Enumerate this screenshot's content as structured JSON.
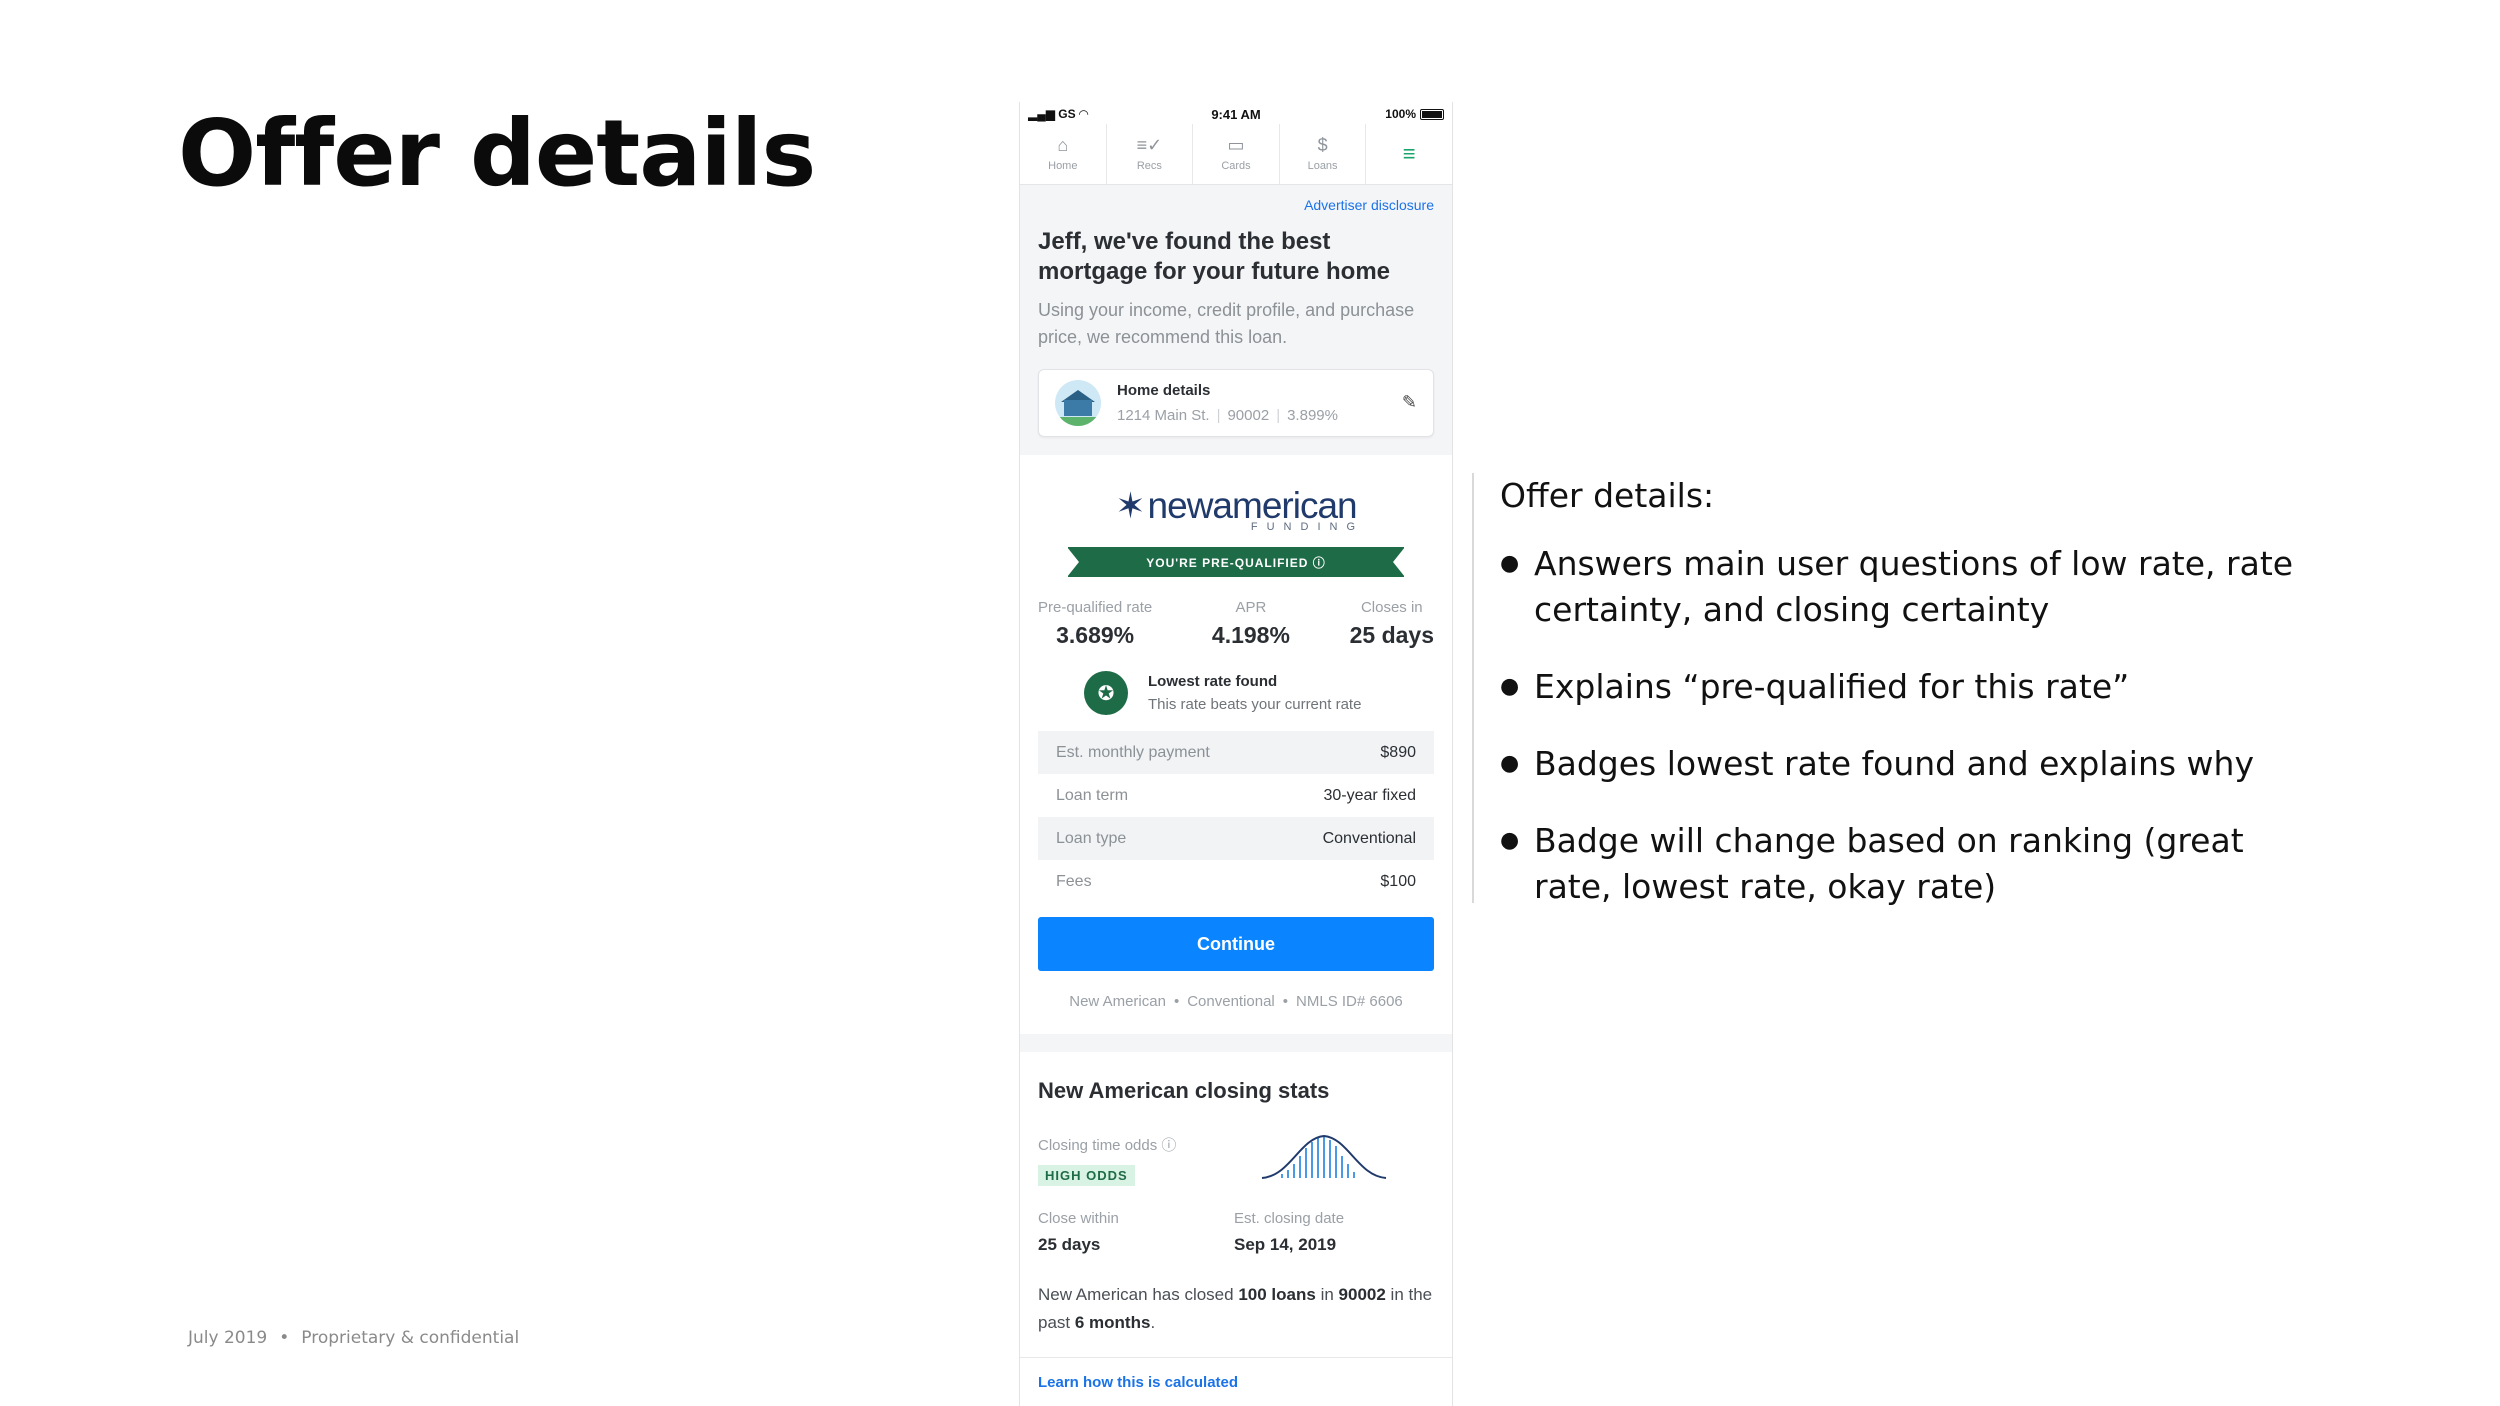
{
  "slide": {
    "title": "Offer details",
    "footer_date": "July 2019",
    "footer_sep": "•",
    "footer_note": "Proprietary & confidential"
  },
  "phone": {
    "status": {
      "carrier": "GS",
      "time": "9:41 AM",
      "battery": "100%"
    },
    "tabs": [
      {
        "label": "Home",
        "icon": "home-icon"
      },
      {
        "label": "Recs",
        "icon": "recs-icon"
      },
      {
        "label": "Cards",
        "icon": "card-icon"
      },
      {
        "label": "Loans",
        "icon": "dollar-icon"
      },
      {
        "label": "",
        "icon": "menu-icon"
      }
    ],
    "disclosure": "Advertiser disclosure",
    "headline": "Jeff, we've found the best mortgage for your future home",
    "subtext": "Using your income, credit profile, and purchase price, we recommend this loan.",
    "home_card": {
      "title": "Home details",
      "address": "1214 Main St.",
      "zip": "90002",
      "rate": "3.899%"
    },
    "offer": {
      "lender_name": "newamerican",
      "lender_tagline": "FUNDING",
      "prequalified_banner": "YOU'RE PRE-QUALIFIED ⓘ",
      "rates": [
        {
          "label": "Pre-qualified rate",
          "value": "3.689%"
        },
        {
          "label": "APR",
          "value": "4.198%"
        },
        {
          "label": "Closes in",
          "value": "25 days"
        }
      ],
      "badge_title": "Lowest rate found",
      "badge_sub": "This rate beats your current rate",
      "details": [
        {
          "key": "Est. monthly payment",
          "value": "$890"
        },
        {
          "key": "Loan term",
          "value": "30-year fixed"
        },
        {
          "key": "Loan type",
          "value": "Conventional"
        },
        {
          "key": "Fees",
          "value": "$100"
        }
      ],
      "continue_label": "Continue",
      "meta": [
        "New American",
        "Conventional",
        "NMLS ID# 6606"
      ]
    },
    "stats": {
      "title": "New American closing stats",
      "odds_label": "Closing time odds",
      "odds_badge": "HIGH ODDS",
      "close_within_label": "Close within",
      "close_within_value": "25 days",
      "closing_date_label": "Est. closing date",
      "closing_date_value": "Sep 14, 2019",
      "closed_prefix": "New American has closed",
      "closed_loans": "100 loans",
      "closed_in": "in",
      "closed_zip": "90002",
      "closed_mid": "in the past",
      "closed_months": "6 months",
      "closed_suffix": ".",
      "learn_link": "Learn how this is calculated"
    }
  },
  "notes": {
    "heading": "Offer details:",
    "bullets": [
      "Answers main user questions of low rate, rate certainty, and closing certainty",
      "Explains “pre-qualified for this rate”",
      "Badges lowest rate found and explains why",
      "Badge will change based on ranking (great rate, lowest rate, okay rate)"
    ]
  },
  "colors": {
    "primary_blue": "#0a84ff",
    "lender_green": "#1e6b47",
    "lender_navy": "#1f3a6b"
  }
}
